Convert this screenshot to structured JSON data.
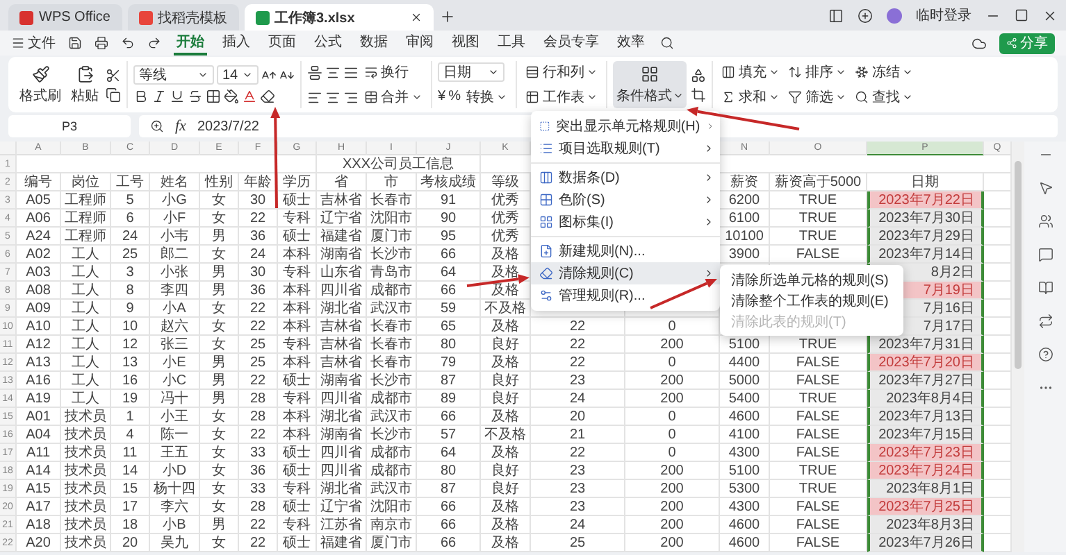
{
  "title_bar": {
    "tabs": [
      {
        "label": "WPS Office",
        "kind": "home",
        "selected": false
      },
      {
        "label": "找稻壳模板",
        "kind": "template",
        "selected": false
      },
      {
        "label": "工作簿3.xlsx",
        "kind": "sheet",
        "selected": true
      }
    ],
    "user": "临时登录"
  },
  "menu_bar": {
    "file": "文件",
    "tabs": [
      {
        "label": "开始",
        "selected": true
      },
      {
        "label": "插入",
        "selected": false
      },
      {
        "label": "页面",
        "selected": false
      },
      {
        "label": "公式",
        "selected": false
      },
      {
        "label": "数据",
        "selected": false
      },
      {
        "label": "审阅",
        "selected": false
      },
      {
        "label": "视图",
        "selected": false
      },
      {
        "label": "工具",
        "selected": false
      },
      {
        "label": "会员专享",
        "selected": false
      },
      {
        "label": "效率",
        "selected": false
      }
    ],
    "share": "分享"
  },
  "ribbon": {
    "format_painter": "格式刷",
    "paste": "粘贴",
    "font": "等线",
    "font_size": "14",
    "wrap": "换行",
    "merge": "合并",
    "number_format": "日期",
    "currency": "¥",
    "percent": "%",
    "convert": "转换",
    "rows_cols": "行和列",
    "worksheet": "工作表",
    "conditional_format": {
      "label": "条件格式",
      "active": true
    },
    "fill": "填充",
    "sort": "排序",
    "freeze": "冻结",
    "sum": "求和",
    "filter": "筛选",
    "find": "查找"
  },
  "formula_bar": {
    "cell": "P3",
    "fx": "fx",
    "formula": "2023/7/22"
  },
  "sheet": {
    "columns": [
      {
        "letter": "A",
        "selected": false
      },
      {
        "letter": "B",
        "selected": false
      },
      {
        "letter": "C",
        "selected": false
      },
      {
        "letter": "D",
        "selected": false
      },
      {
        "letter": "E",
        "selected": false
      },
      {
        "letter": "F",
        "selected": false
      },
      {
        "letter": "G",
        "selected": false
      },
      {
        "letter": "H",
        "selected": false
      },
      {
        "letter": "I",
        "selected": false
      },
      {
        "letter": "J",
        "selected": false
      },
      {
        "letter": "K",
        "selected": false
      }
    ],
    "columns_right": [
      {
        "letter": "N",
        "selected": false
      },
      {
        "letter": "O",
        "selected": false
      },
      {
        "letter": "P",
        "selected": true
      },
      {
        "letter": "Q",
        "selected": false
      }
    ],
    "title_row": "1",
    "title": "XXX公司员工信息",
    "header_row": "2",
    "header": [
      "编号",
      "岗位",
      "工号",
      "姓名",
      "性别",
      "年龄",
      "学历",
      "省",
      "市",
      "考核成绩",
      "等级"
    ],
    "header_right": [
      "薪资",
      "薪资高于5000",
      "日期"
    ],
    "rows": [
      {
        "number": "3",
        "cells": [
          "A05",
          "工程师",
          "5",
          "小G",
          "女",
          "30",
          "硕士",
          "吉林省",
          "长春市",
          "91",
          "优秀"
        ],
        "salary": "6200",
        "salary_over_5000": "TRUE",
        "date": {
          "text": "2023年7月22日",
          "highlighted": true
        }
      },
      {
        "number": "4",
        "cells": [
          "A06",
          "工程师",
          "6",
          "小F",
          "女",
          "22",
          "专科",
          "辽宁省",
          "沈阳市",
          "90",
          "优秀"
        ],
        "salary": "6100",
        "salary_over_5000": "TRUE",
        "date": {
          "text": "2023年7月30日",
          "highlighted": false
        }
      },
      {
        "number": "5",
        "cells": [
          "A24",
          "工程师",
          "24",
          "小韦",
          "男",
          "36",
          "硕士",
          "福建省",
          "厦门市",
          "95",
          "优秀"
        ],
        "salary": "10100",
        "salary_over_5000": "TRUE",
        "date": {
          "text": "2023年7月29日",
          "highlighted": false
        }
      },
      {
        "number": "6",
        "cells": [
          "A02",
          "工人",
          "25",
          "郎二",
          "女",
          "24",
          "本科",
          "湖南省",
          "长沙市",
          "66",
          "及格"
        ],
        "salary": "3900",
        "salary_over_5000": "FALSE",
        "date": {
          "text": "2023年7月14日",
          "highlighted": false
        }
      },
      {
        "number": "7",
        "cells": [
          "A03",
          "工人",
          "3",
          "小张",
          "男",
          "30",
          "专科",
          "山东省",
          "青岛市",
          "64",
          "及格"
        ],
        "date": {
          "text": "8月2日",
          "highlighted": false
        }
      },
      {
        "number": "8",
        "cells": [
          "A08",
          "工人",
          "8",
          "李四",
          "男",
          "36",
          "本科",
          "四川省",
          "成都市",
          "66",
          "及格"
        ],
        "date": {
          "text": "7月19日",
          "highlighted": true
        }
      },
      {
        "number": "9",
        "cells": [
          "A09",
          "工人",
          "9",
          "小A",
          "女",
          "22",
          "本科",
          "湖北省",
          "武汉市",
          "59",
          "不及格"
        ],
        "date": {
          "text": "7月16日",
          "highlighted": false
        }
      },
      {
        "number": "10",
        "cells": [
          "A10",
          "工人",
          "10",
          "赵六",
          "女",
          "22",
          "本科",
          "吉林省",
          "长春市",
          "65",
          "及格"
        ],
        "column_12": "22",
        "column_13": "0",
        "date": {
          "text": "7月17日",
          "highlighted": false
        }
      },
      {
        "number": "11",
        "cells": [
          "A12",
          "工人",
          "12",
          "张三",
          "女",
          "25",
          "专科",
          "吉林省",
          "长春市",
          "80",
          "良好"
        ],
        "column_12": "22",
        "column_13": "200",
        "salary": "5100",
        "salary_over_5000": "TRUE",
        "date": {
          "text": "2023年7月31日",
          "highlighted": false
        }
      },
      {
        "number": "12",
        "cells": [
          "A13",
          "工人",
          "13",
          "小E",
          "男",
          "25",
          "本科",
          "吉林省",
          "长春市",
          "79",
          "及格"
        ],
        "column_12": "22",
        "column_13": "0",
        "salary": "4400",
        "salary_over_5000": "FALSE",
        "date": {
          "text": "2023年7月20日",
          "highlighted": true
        }
      },
      {
        "number": "13",
        "cells": [
          "A16",
          "工人",
          "16",
          "小C",
          "男",
          "22",
          "硕士",
          "湖南省",
          "长沙市",
          "87",
          "良好"
        ],
        "column_12": "23",
        "column_13": "200",
        "salary": "5000",
        "salary_over_5000": "FALSE",
        "date": {
          "text": "2023年7月27日",
          "highlighted": false
        }
      },
      {
        "number": "14",
        "cells": [
          "A19",
          "工人",
          "19",
          "冯十",
          "男",
          "28",
          "专科",
          "四川省",
          "成都市",
          "89",
          "良好"
        ],
        "column_12": "24",
        "column_13": "200",
        "salary": "5400",
        "salary_over_5000": "TRUE",
        "date": {
          "text": "2023年8月4日",
          "highlighted": false
        }
      },
      {
        "number": "15",
        "cells": [
          "A01",
          "技术员",
          "1",
          "小王",
          "女",
          "28",
          "本科",
          "湖北省",
          "武汉市",
          "66",
          "及格"
        ],
        "column_12": "20",
        "column_13": "0",
        "salary": "4600",
        "salary_over_5000": "FALSE",
        "date": {
          "text": "2023年7月13日",
          "highlighted": false
        }
      },
      {
        "number": "16",
        "cells": [
          "A04",
          "技术员",
          "4",
          "陈一",
          "女",
          "22",
          "本科",
          "湖南省",
          "长沙市",
          "57",
          "不及格"
        ],
        "column_12": "21",
        "column_13": "0",
        "salary": "4100",
        "salary_over_5000": "FALSE",
        "date": {
          "text": "2023年7月15日",
          "highlighted": false
        }
      },
      {
        "number": "17",
        "cells": [
          "A11",
          "技术员",
          "11",
          "王五",
          "女",
          "33",
          "硕士",
          "四川省",
          "成都市",
          "64",
          "及格"
        ],
        "column_12": "22",
        "column_13": "0",
        "salary": "4300",
        "salary_over_5000": "FALSE",
        "date": {
          "text": "2023年7月23日",
          "highlighted": true
        }
      },
      {
        "number": "18",
        "cells": [
          "A14",
          "技术员",
          "14",
          "小D",
          "女",
          "36",
          "硕士",
          "四川省",
          "成都市",
          "80",
          "良好"
        ],
        "column_12": "23",
        "column_13": "200",
        "salary": "5100",
        "salary_over_5000": "TRUE",
        "date": {
          "text": "2023年7月24日",
          "highlighted": true
        }
      },
      {
        "number": "19",
        "cells": [
          "A15",
          "技术员",
          "15",
          "杨十四",
          "女",
          "33",
          "专科",
          "湖北省",
          "武汉市",
          "87",
          "良好"
        ],
        "column_12": "23",
        "column_13": "200",
        "salary": "5300",
        "salary_over_5000": "TRUE",
        "date": {
          "text": "2023年8月1日",
          "highlighted": false
        }
      },
      {
        "number": "20",
        "cells": [
          "A17",
          "技术员",
          "17",
          "李六",
          "女",
          "28",
          "硕士",
          "辽宁省",
          "沈阳市",
          "66",
          "及格"
        ],
        "column_12": "23",
        "column_13": "200",
        "salary": "4300",
        "salary_over_5000": "FALSE",
        "date": {
          "text": "2023年7月25日",
          "highlighted": true
        }
      },
      {
        "number": "21",
        "cells": [
          "A18",
          "技术员",
          "18",
          "小B",
          "男",
          "22",
          "专科",
          "江苏省",
          "南京市",
          "66",
          "及格"
        ],
        "column_12": "24",
        "column_13": "200",
        "salary": "4600",
        "salary_over_5000": "FALSE",
        "date": {
          "text": "2023年8月3日",
          "highlighted": false
        }
      },
      {
        "number": "22",
        "cells": [
          "A20",
          "技术员",
          "20",
          "吴九",
          "女",
          "22",
          "硕士",
          "福建省",
          "厦门市",
          "66",
          "及格"
        ],
        "column_12": "25",
        "column_13": "200",
        "salary": "4600",
        "salary_over_5000": "FALSE",
        "date": {
          "text": "2023年7月26日",
          "highlighted": false
        }
      }
    ]
  },
  "menu": {
    "items": [
      {
        "label": "突出显示单元格规则(H)",
        "has_submenu": true,
        "selected": false
      },
      {
        "label": "项目选取规则(T)",
        "has_submenu": true,
        "selected": false
      },
      {
        "label": "数据条(D)",
        "has_submenu": true,
        "selected": false
      },
      {
        "label": "色阶(S)",
        "has_submenu": true,
        "selected": false
      },
      {
        "label": "图标集(I)",
        "has_submenu": true,
        "selected": false
      },
      {
        "label": "新建规则(N)...",
        "has_submenu": false,
        "selected": false
      },
      {
        "label": "清除规则(C)",
        "has_submenu": true,
        "selected": true
      },
      {
        "label": "管理规则(R)...",
        "has_submenu": false,
        "selected": false
      }
    ],
    "submenu": [
      {
        "label": "清除所选单元格的规则(S)",
        "disabled": false
      },
      {
        "label": "清除整个工作表的规则(E)",
        "disabled": false
      },
      {
        "label": "清除此表的规则(T)",
        "disabled": true
      }
    ]
  }
}
